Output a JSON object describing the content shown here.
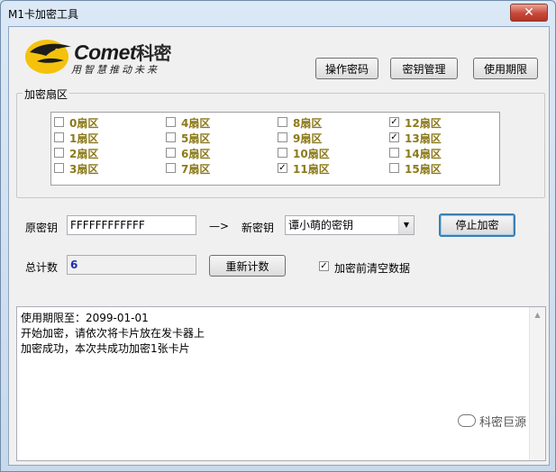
{
  "window": {
    "title": "M1卡加密工具",
    "close_glyph": "✕"
  },
  "logo": {
    "brand": "Comet",
    "brand_cn": "科密",
    "tagline": "用智慧推动未来"
  },
  "toolbar": {
    "op_password": "操作密码",
    "key_manage": "密钥管理",
    "validity": "使用期限"
  },
  "sector_group": {
    "label": "加密扇区",
    "sectors": [
      {
        "label": "0扇区",
        "checked": false
      },
      {
        "label": "1扇区",
        "checked": false
      },
      {
        "label": "2扇区",
        "checked": false
      },
      {
        "label": "3扇区",
        "checked": false
      },
      {
        "label": "4扇区",
        "checked": false
      },
      {
        "label": "5扇区",
        "checked": false
      },
      {
        "label": "6扇区",
        "checked": false
      },
      {
        "label": "7扇区",
        "checked": false
      },
      {
        "label": "8扇区",
        "checked": false
      },
      {
        "label": "9扇区",
        "checked": false
      },
      {
        "label": "10扇区",
        "checked": false
      },
      {
        "label": "11扇区",
        "checked": true
      },
      {
        "label": "12扇区",
        "checked": true
      },
      {
        "label": "13扇区",
        "checked": true
      },
      {
        "label": "14扇区",
        "checked": false
      },
      {
        "label": "15扇区",
        "checked": false
      }
    ]
  },
  "keys": {
    "old_label": "原密钥",
    "old_value": "FFFFFFFFFFFF",
    "arrow": "—>",
    "new_label": "新密钥",
    "new_value": "谭小萌的密钥",
    "stop_button": "停止加密"
  },
  "count": {
    "label": "总计数",
    "value": "6",
    "recount_button": "重新计数",
    "clear_checkbox_label": "加密前清空数据",
    "clear_checked": true
  },
  "log": {
    "lines": [
      "使用期限至：2099-01-01",
      "开始加密，请依次将卡片放在发卡器上",
      "加密成功，本次共成功加密1张卡片"
    ]
  },
  "watermark": "科密巨源"
}
